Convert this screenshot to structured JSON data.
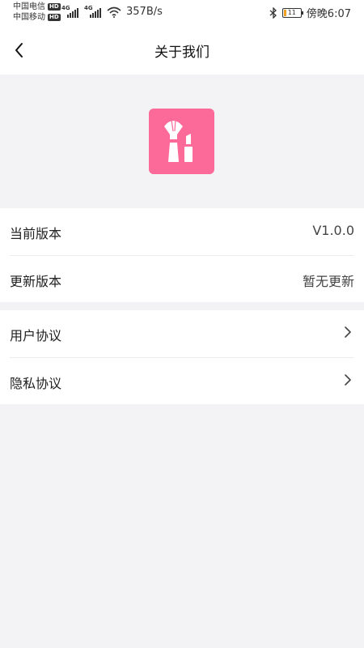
{
  "status_bar": {
    "carrier1": "中国电信",
    "carrier2": "中国移动",
    "hd": "HD",
    "net": "4G",
    "speed": "357B/s",
    "battery": "11",
    "time": "傍晚6:07"
  },
  "header": {
    "title": "关于我们"
  },
  "app": {
    "logo_icon": "makeup-brush-lipstick-icon",
    "accent": "#fb6a98"
  },
  "info": [
    {
      "label": "当前版本",
      "value": "V1.0.0"
    },
    {
      "label": "更新版本",
      "value": "暂无更新"
    }
  ],
  "links": [
    {
      "label": "用户协议"
    },
    {
      "label": "隐私协议"
    }
  ]
}
